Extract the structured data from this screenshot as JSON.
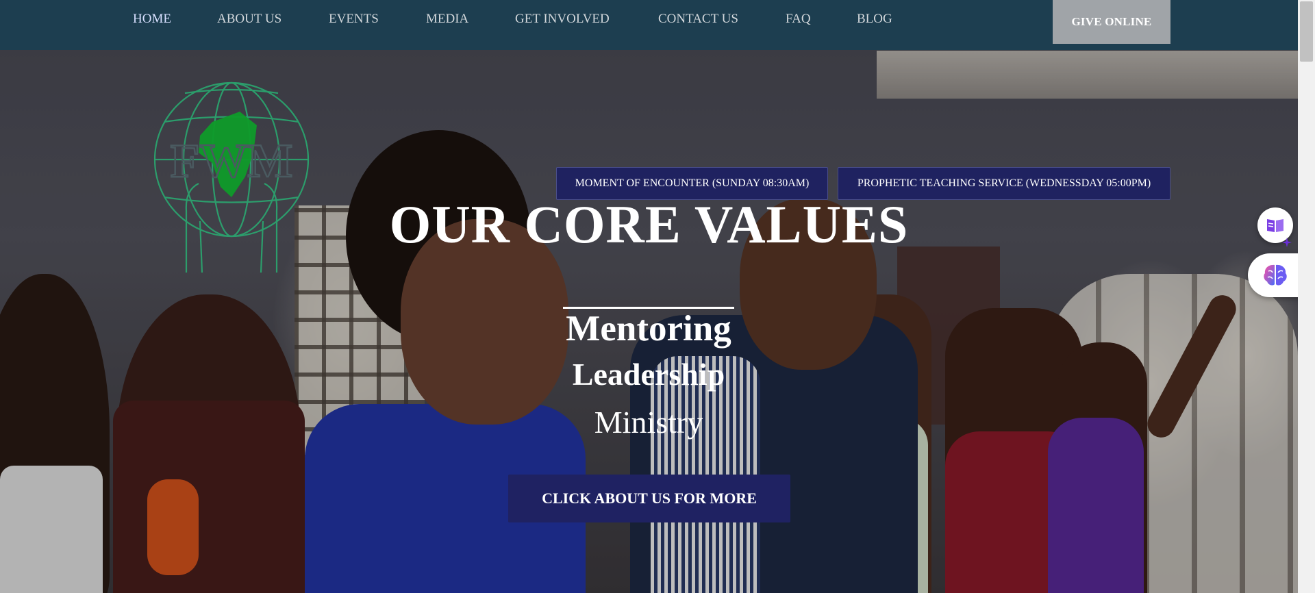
{
  "nav": {
    "items": [
      {
        "label": "HOME"
      },
      {
        "label": "ABOUT US"
      },
      {
        "label": "EVENTS"
      },
      {
        "label": "MEDIA"
      },
      {
        "label": "GET INVOLVED"
      },
      {
        "label": "CONTACT US"
      },
      {
        "label": "FAQ"
      },
      {
        "label": "BLOG"
      }
    ],
    "give_label": "GIVE ONLINE"
  },
  "logo": {
    "text": "FWM"
  },
  "services": {
    "sunday": "MOMENT OF ENCOUNTER (SUNDAY 08:30AM)",
    "wednesday": "PROPHETIC TEACHING SERVICE (WEDNESSDAY 05:00PM)"
  },
  "hero": {
    "title": "OUR CORE VALUES",
    "values": [
      "Mentoring",
      "Leadership",
      "Ministry"
    ],
    "cta_label": "CLICK ABOUT US FOR MORE"
  },
  "widgets": {
    "reader_icon": "book-icon",
    "brain_icon": "brain-icon"
  },
  "colors": {
    "nav_bg": "#1d3e50",
    "give_bg": "#a0a4a8",
    "badge_bg": "#1f2260",
    "cta_bg": "#1f2262",
    "logo_green": "#1fa84a"
  }
}
